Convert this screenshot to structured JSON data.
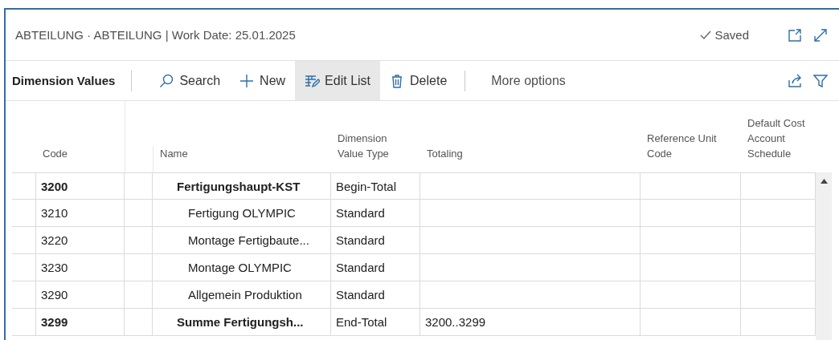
{
  "window": {
    "title": "ABTEILUNG · ABTEILUNG | Work Date: 25.01.2025",
    "save_status": "Saved"
  },
  "toolbar": {
    "title": "Dimension Values",
    "actions": [
      {
        "kind": "search",
        "label": "Search",
        "selected": false
      },
      {
        "kind": "new",
        "label": "New",
        "selected": false
      },
      {
        "kind": "edit",
        "label": "Edit List",
        "selected": true
      },
      {
        "kind": "delete",
        "label": "Delete",
        "selected": false
      },
      {
        "kind": "more",
        "label": "More options",
        "selected": false
      }
    ]
  },
  "table": {
    "columns": [
      "Code",
      "Name",
      "Dimension Value Type",
      "Totaling",
      "Reference Unit Code",
      "Default Cost Account Schedule"
    ],
    "rows": [
      {
        "code": "3200",
        "name": "Fertigungshaupt-KST",
        "type": "Begin-Total",
        "bold": true,
        "children": [
          {
            "code": "3210",
            "name": "Fertigung OLYMPIC",
            "type": "Standard",
            "bold": false
          },
          {
            "code": "3220",
            "name": "Montage Fertigbaute...",
            "type": "Standard",
            "bold": false
          },
          {
            "code": "3230",
            "name": "Montage OLYMPIC",
            "type": "Standard",
            "bold": false
          },
          {
            "code": "3290",
            "name": "Allgemein Produktion",
            "type": "Standard",
            "bold": false
          }
        ]
      },
      {
        "code": "3299",
        "name": "Summe Fertigungsh...",
        "type": "End-Total",
        "totaling": "3200..3299",
        "bold": true
      }
    ]
  }
}
